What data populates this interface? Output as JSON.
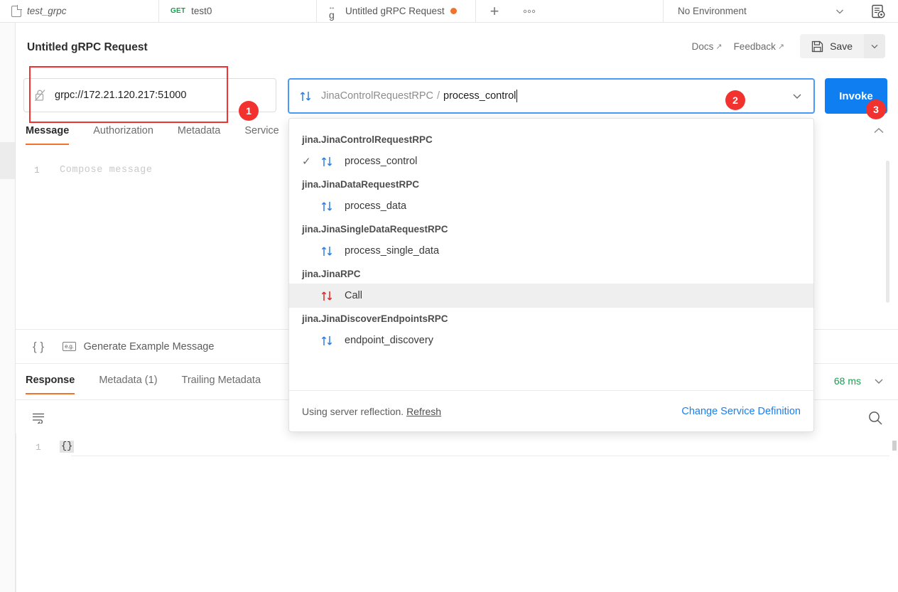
{
  "tabbar": {
    "tabs": [
      {
        "name": "test_grpc",
        "icon": "document-icon",
        "method": ""
      },
      {
        "name": "test0",
        "icon": "",
        "method": "GET"
      },
      {
        "name": "Untitled gRPC Request",
        "icon": "grpc-icon",
        "method": "",
        "unsaved": true
      }
    ],
    "new_tab_label": "+",
    "more_label": "○○○",
    "environment": "No Environment",
    "env_caret": "chevron-down-icon",
    "env_quick_look": "environment-quick-look-icon"
  },
  "header": {
    "title": "Untitled gRPC Request",
    "docs_label": "Docs",
    "feedback_label": "Feedback",
    "external_arrow": "↗",
    "save_label": "Save",
    "save_icon": "floppy-disk-icon",
    "save_caret": "chevron-down-icon"
  },
  "request": {
    "url_value": "grpc://172.21.120.217:51000",
    "url_icon": "unlocked-padlock-icon",
    "method_service": "JinaControlRequestRPC",
    "method_separator": "/",
    "method_name": "process_control",
    "method_icon": "bidirectional-arrows-icon",
    "method_caret": "chevron-down-icon",
    "invoke_label": "Invoke",
    "collapse_caret": "chevron-up-icon"
  },
  "annotations": {
    "badges": [
      "1",
      "2",
      "3"
    ],
    "box_color": "#f1322e",
    "badge_color": "#f1322e"
  },
  "request_tabs": [
    {
      "label": "Message",
      "active": true
    },
    {
      "label": "Authorization",
      "active": false
    },
    {
      "label": "Metadata",
      "active": false
    },
    {
      "label": "Service",
      "active": false
    }
  ],
  "editor": {
    "line_number": "1",
    "placeholder": "Compose message"
  },
  "editor_tools": {
    "brace_icon": "{ }",
    "example_icon": "e.g.",
    "generate_label": "Generate Example Message"
  },
  "response": {
    "tabs": [
      {
        "label": "Response",
        "active": true
      },
      {
        "label": "Metadata (1)",
        "active": false
      },
      {
        "label": "Trailing Metadata",
        "active": false
      }
    ],
    "time": "68 ms",
    "time_color": "#1a9d50",
    "collapse_caret": "chevron-down-icon",
    "wrap_icon": "word-wrap-icon",
    "search_icon": "search-icon",
    "body_line_number": "1",
    "body_value": "{}"
  },
  "dropdown": {
    "groups": [
      {
        "service": "jina.JinaControlRequestRPC",
        "methods": [
          {
            "name": "process_control",
            "selected": true,
            "highlighted": false,
            "stream": "blue"
          }
        ]
      },
      {
        "service": "jina.JinaDataRequestRPC",
        "methods": [
          {
            "name": "process_data",
            "selected": false,
            "highlighted": false,
            "stream": "blue"
          }
        ]
      },
      {
        "service": "jina.JinaSingleDataRequestRPC",
        "methods": [
          {
            "name": "process_single_data",
            "selected": false,
            "highlighted": false,
            "stream": "blue"
          }
        ]
      },
      {
        "service": "jina.JinaRPC",
        "methods": [
          {
            "name": "Call",
            "selected": false,
            "highlighted": true,
            "stream": "red"
          }
        ]
      },
      {
        "service": "jina.JinaDiscoverEndpointsRPC",
        "methods": [
          {
            "name": "endpoint_discovery",
            "selected": false,
            "highlighted": false,
            "stream": "blue"
          }
        ]
      }
    ],
    "footer_text": "Using server reflection.",
    "refresh_label": "Refresh",
    "change_service_label": "Change Service Definition",
    "check_glyph": "✓"
  },
  "colors": {
    "accent_orange": "#f2722b",
    "invoke_blue": "#0f7ef0",
    "focus_blue": "#4a9bf5",
    "stream_blue": "#2f7fe0",
    "stream_red": "#e03131",
    "green": "#1a9d50"
  }
}
